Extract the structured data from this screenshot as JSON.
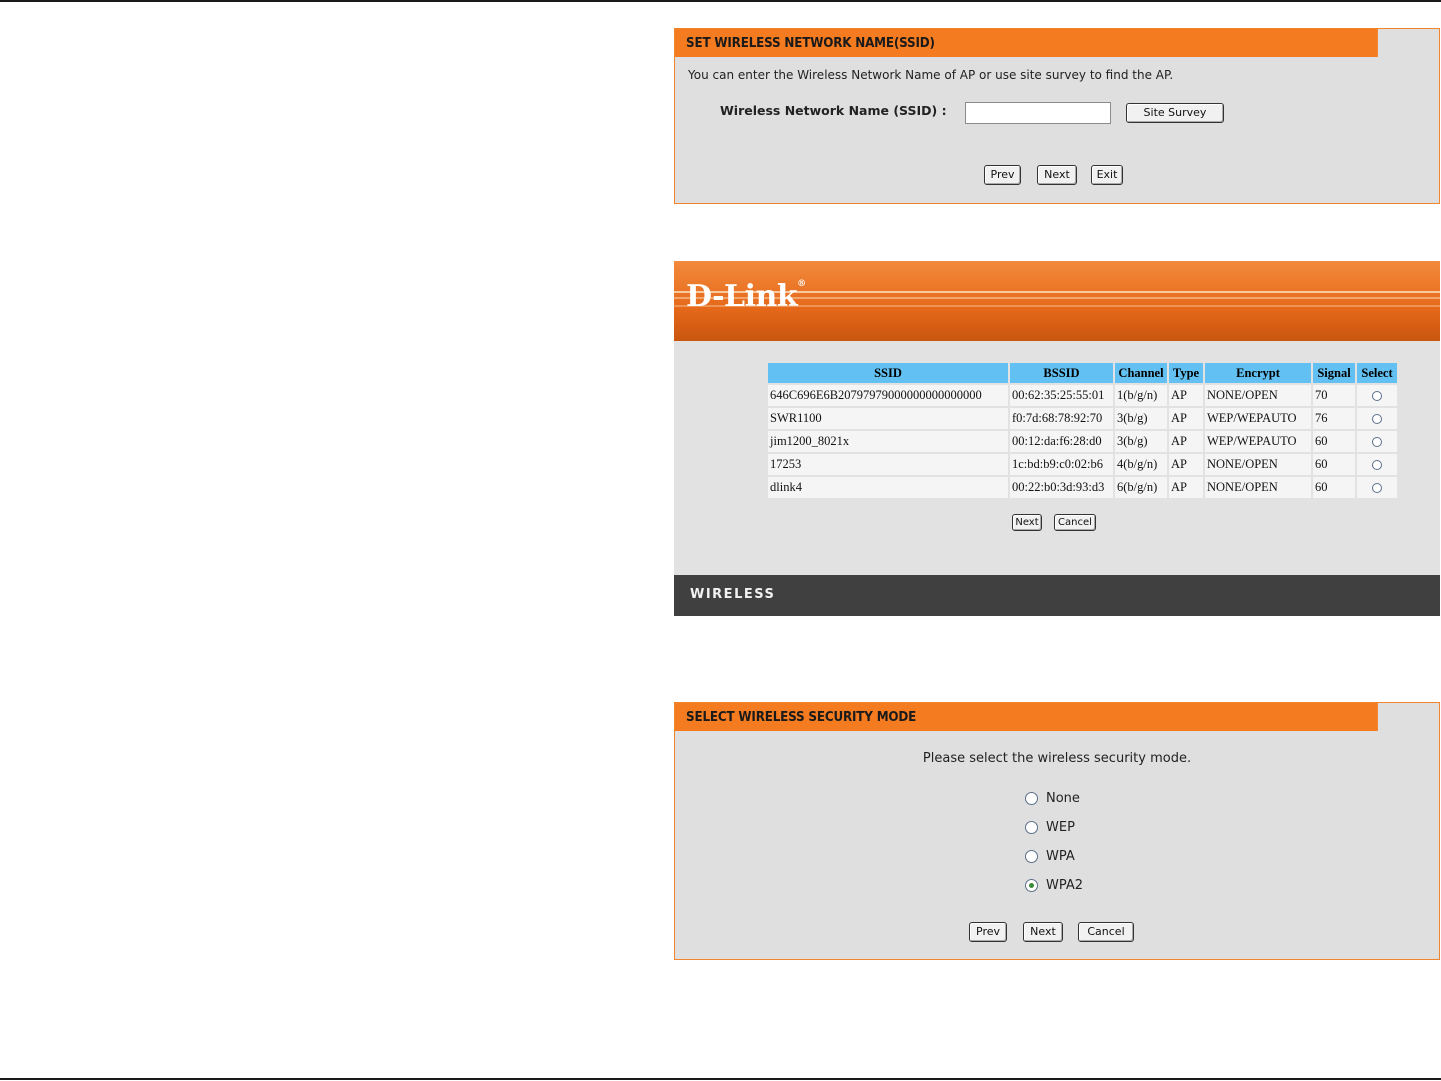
{
  "ssid_panel": {
    "title": "SET WIRELESS NETWORK NAME(SSID)",
    "description": "You can enter the Wireless Network Name of AP or use site survey to find the AP.",
    "field_label": "Wireless Network Name (SSID) :",
    "field_value": "",
    "site_survey": "Site Survey",
    "prev": "Prev",
    "next": "Next",
    "exit": "Exit"
  },
  "survey_panel": {
    "logo": "D-Link",
    "logo_mark": "®",
    "footer": "WIRELESS",
    "headers": [
      "SSID",
      "BSSID",
      "Channel",
      "Type",
      "Encrypt",
      "Signal",
      "Select"
    ],
    "rows": [
      {
        "ssid": "646C696E6B20797979000000000000000",
        "bssid": "00:62:35:25:55:01",
        "channel": "1(b/g/n)",
        "type": "AP",
        "encrypt": "NONE/OPEN",
        "signal": "70"
      },
      {
        "ssid": "SWR1100",
        "bssid": "f0:7d:68:78:92:70",
        "channel": "3(b/g)",
        "type": "AP",
        "encrypt": "WEP/WEPAUTO",
        "signal": "76"
      },
      {
        "ssid": "jim1200_8021x",
        "bssid": "00:12:da:f6:28:d0",
        "channel": "3(b/g)",
        "type": "AP",
        "encrypt": "WEP/WEPAUTO",
        "signal": "60"
      },
      {
        "ssid": "17253",
        "bssid": "1c:bd:b9:c0:02:b6",
        "channel": "4(b/g/n)",
        "type": "AP",
        "encrypt": "NONE/OPEN",
        "signal": "60"
      },
      {
        "ssid": "dlink4",
        "bssid": "00:22:b0:3d:93:d3",
        "channel": "6(b/g/n)",
        "type": "AP",
        "encrypt": "NONE/OPEN",
        "signal": "60"
      }
    ],
    "next": "Next",
    "cancel": "Cancel"
  },
  "security_panel": {
    "title": "SELECT WIRELESS SECURITY MODE",
    "prompt": "Please select the wireless security mode.",
    "options": [
      {
        "label": "None",
        "selected": false
      },
      {
        "label": "WEP",
        "selected": false
      },
      {
        "label": "WPA",
        "selected": false
      },
      {
        "label": "WPA2",
        "selected": true
      }
    ],
    "prev": "Prev",
    "next": "Next",
    "cancel": "Cancel"
  },
  "colors": {
    "orange": "#f47b20",
    "panel_bg": "#dfdfdf",
    "table_header": "#62c1f2",
    "footer_bar": "#404040"
  }
}
